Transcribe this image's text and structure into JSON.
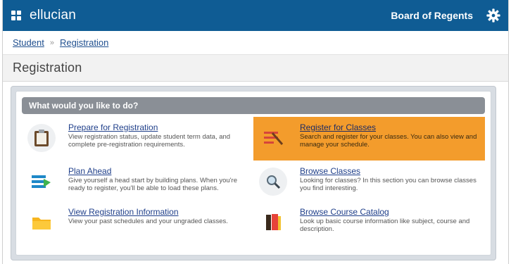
{
  "header": {
    "brand": "ellucian",
    "institution": "Board of Regents",
    "icons": {
      "apps": "apps-grid-icon",
      "settings": "gear-icon"
    },
    "colors": {
      "topbar": "#0f5c94"
    }
  },
  "breadcrumb": {
    "items": [
      "Student",
      "Registration"
    ],
    "separator": "»"
  },
  "page": {
    "title": "Registration"
  },
  "panel": {
    "header": "What would you like to do?",
    "items": [
      {
        "title": "Prepare for Registration",
        "description": "View registration status, update student term data, and complete pre-registration requirements.",
        "icon": "clipboard-icon",
        "selected": false
      },
      {
        "title": "Register for Classes",
        "description": "Search and register for your classes. You can also view and manage your schedule.",
        "icon": "register-icon",
        "selected": true
      },
      {
        "title": "Plan Ahead",
        "description": "Give yourself a head start by building plans. When you're ready to register, you'll be able to load these plans.",
        "icon": "plan-ahead-icon",
        "selected": false
      },
      {
        "title": "Browse Classes",
        "description": "Looking for classes? In this section you can browse classes you find interesting.",
        "icon": "magnifier-icon",
        "selected": false
      },
      {
        "title": "View Registration Information",
        "description": "View your past schedules and your ungraded classes.",
        "icon": "folder-icon",
        "selected": false
      },
      {
        "title": "Browse Course Catalog",
        "description": "Look up basic course information like subject, course and description.",
        "icon": "catalog-books-icon",
        "selected": false
      }
    ],
    "colors": {
      "selected": "#f39c2c",
      "header": "#8a8f96"
    }
  }
}
